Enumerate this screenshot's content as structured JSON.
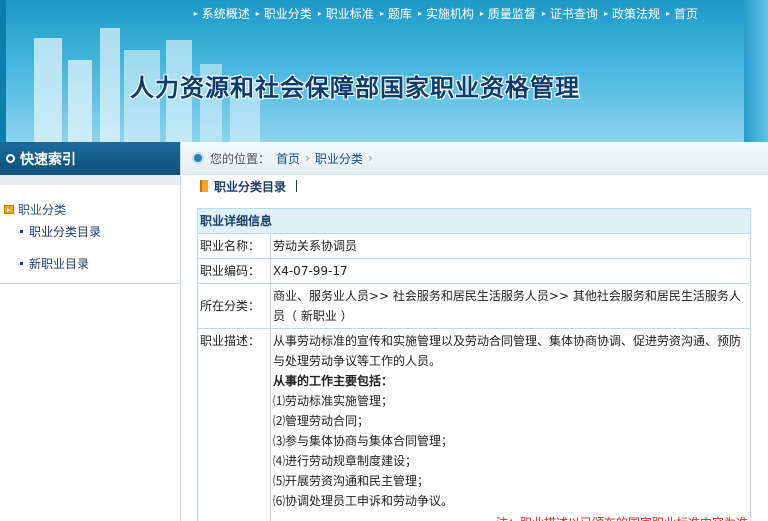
{
  "header": {
    "title": "人力资源和社会保障部国家职业资格管理",
    "nav": [
      "系统概述",
      "职业分类",
      "职业标准",
      "题库",
      "实施机构",
      "质量监督",
      "证书查询",
      "政策法规",
      "首页"
    ]
  },
  "sidebar": {
    "title": "快速索引",
    "category": "职业分类",
    "items": [
      "职业分类目录",
      "新职业目录"
    ]
  },
  "breadcrumb": {
    "prefix": "您的位置：",
    "items": [
      "首页",
      "职业分类"
    ]
  },
  "section": {
    "title": "职业分类目录"
  },
  "detail": {
    "heading": "职业详细信息",
    "name_label": "职业名称：",
    "name": "劳动关系协调员",
    "code_label": "职业编码：",
    "code": "X4-07-99-17",
    "category_label": "所在分类：",
    "category": "商业、服务业人员>> 社会服务和居民生活服务人员>> 其他社会服务和居民生活服务人员（ 新职业 ）",
    "desc_label": "职业描述：",
    "desc": "从事劳动标准的宣传和实施管理以及劳动合同管理、集体协商协调、促进劳资沟通、预防与处理劳动争议等工作的人员。",
    "tasks_heading": "从事的工作主要包括：",
    "tasks": [
      "⑴劳动标准实施管理；",
      "⑵管理劳动合同；",
      "⑶参与集体协商与集体合同管理；",
      "⑷进行劳动规章制度建设；",
      "⑸开展劳资沟通和民主管理；",
      "⑹协调处理员工申诉和劳动争议。"
    ],
    "note": "注：职业描述以已颁布的国家职业标准内容为准"
  },
  "colors": {
    "banner": "#45b6dd",
    "sidebar_head": "#0f4f79",
    "note": "#d8281f",
    "table_border": "#b9dbe3"
  }
}
